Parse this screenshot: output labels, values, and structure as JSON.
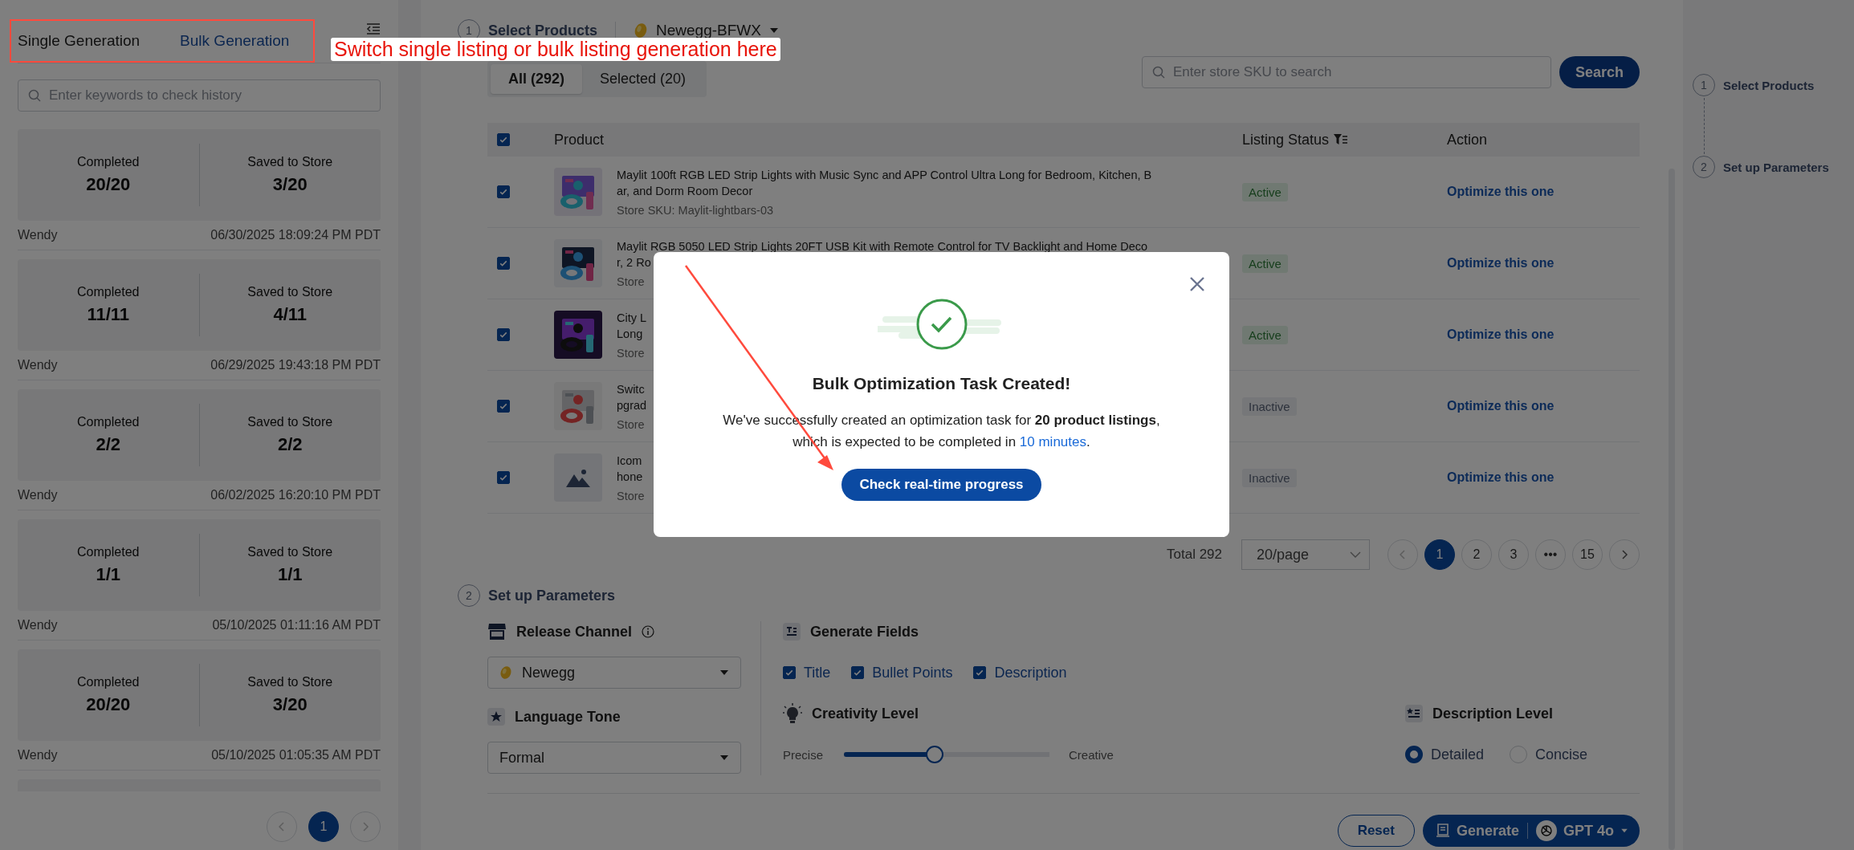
{
  "annotation": {
    "text": "Switch single listing or bulk listing generation here"
  },
  "sidebar": {
    "tabs": [
      {
        "label": "Single Generation",
        "selected": false
      },
      {
        "label": "Bulk Generation",
        "selected": true
      }
    ],
    "search": {
      "placeholder": "Enter keywords to check history"
    },
    "history": [
      {
        "completed_label": "Completed",
        "completed": "20/20",
        "saved_label": "Saved to Store",
        "saved": "3/20",
        "user": "Wendy",
        "time": "06/30/2025 18:09:24 PM PDT"
      },
      {
        "completed_label": "Completed",
        "completed": "11/11",
        "saved_label": "Saved to Store",
        "saved": "4/11",
        "user": "Wendy",
        "time": "06/29/2025 19:43:18 PM PDT"
      },
      {
        "completed_label": "Completed",
        "completed": "2/2",
        "saved_label": "Saved to Store",
        "saved": "2/2",
        "user": "Wendy",
        "time": "06/02/2025 16:20:10 PM PDT"
      },
      {
        "completed_label": "Completed",
        "completed": "1/1",
        "saved_label": "Saved to Store",
        "saved": "1/1",
        "user": "Wendy",
        "time": "05/10/2025 01:11:16 AM PDT"
      },
      {
        "completed_label": "Completed",
        "completed": "20/20",
        "saved_label": "Saved to Store",
        "saved": "3/20",
        "user": "Wendy",
        "time": "05/10/2025 01:05:35 AM PDT"
      }
    ],
    "pagination": {
      "pages": [
        {
          "label": "1",
          "selected": true
        }
      ]
    }
  },
  "select_products": {
    "step": "1",
    "title": "Select Products",
    "store": "Newegg-BFWX",
    "filters": [
      {
        "label": "All (292)",
        "selected": true
      },
      {
        "label": "Selected (20)",
        "selected": false
      }
    ],
    "search": {
      "placeholder": "Enter store SKU to search"
    },
    "search_button": "Search",
    "table": {
      "all_checked": true,
      "columns": [
        "Product",
        "Listing Status",
        "Action"
      ],
      "rows": [
        {
          "checked": true,
          "title": [
            "Maylit 100ft RGB LED Strip Lights with Music Sync and APP Control Ultra Long for Bedroom, Kitchen, B",
            "ar, and Dorm Room Decor"
          ],
          "sku": "Store SKU: Maylit-lightbars-03",
          "status": {
            "label": "Active",
            "kind": "active"
          },
          "action": "Optimize this one"
        },
        {
          "checked": true,
          "title": [
            "Maylit RGB 5050 LED Strip Lights 20FT USB Kit with Remote Control for TV Backlight and Home Deco",
            "r, 2 Ro"
          ],
          "sku": "Store",
          "status": {
            "label": "Active",
            "kind": "active"
          },
          "action": "Optimize this one"
        },
        {
          "checked": true,
          "title": [
            "City L",
            "Long"
          ],
          "sku": "Store",
          "status": {
            "label": "Active",
            "kind": "active"
          },
          "action": "Optimize this one"
        },
        {
          "checked": true,
          "title": [
            "Switc",
            "pgrad"
          ],
          "sku": "Store",
          "status": {
            "label": "Inactive",
            "kind": "inactive"
          },
          "action": "Optimize this one"
        },
        {
          "checked": true,
          "kind": "placeholder",
          "title": [
            "Icom",
            "hone"
          ],
          "sku": "Store",
          "status": {
            "label": "Inactive",
            "kind": "inactive"
          },
          "action": "Optimize this one"
        }
      ]
    },
    "pagination": {
      "total": "Total 292",
      "page_size": "20/page",
      "pages": [
        {
          "label": "1",
          "selected": true
        },
        {
          "label": "2",
          "selected": false
        },
        {
          "label": "3",
          "selected": false
        },
        {
          "label": "•••",
          "selected": false
        },
        {
          "label": "15",
          "selected": false
        }
      ]
    }
  },
  "parameters": {
    "step": "2",
    "title": "Set up Parameters",
    "release_channel": {
      "label": "Release Channel",
      "value": "Newegg"
    },
    "language_tone": {
      "label": "Language Tone",
      "value": "Formal"
    },
    "generate_fields": {
      "label": "Generate Fields",
      "options": [
        {
          "label": "Title",
          "checked": true
        },
        {
          "label": "Bullet Points",
          "checked": true
        },
        {
          "label": "Description",
          "checked": true
        }
      ]
    },
    "creativity": {
      "label": "Creativity Level",
      "min_label": "Precise",
      "max_label": "Creative",
      "level": 0.44
    },
    "description_level": {
      "label": "Description Level",
      "options": [
        {
          "label": "Detailed",
          "selected": true
        },
        {
          "label": "Concise",
          "selected": false
        }
      ]
    },
    "reset_button": "Reset",
    "generate_button": "Generate",
    "model": "GPT 4o"
  },
  "steps": [
    {
      "number": "1",
      "label": "Select Products"
    },
    {
      "number": "2",
      "label": "Set up Parameters"
    }
  ],
  "modal": {
    "title": "Bulk Optimization Task Created!",
    "message": "We've successfully created an optimization task for **20 product listings**,",
    "message_2": "which is expected to be completed in",
    "highlight": "10 minutes",
    "end": ".",
    "button": "Check real-time progress"
  }
}
